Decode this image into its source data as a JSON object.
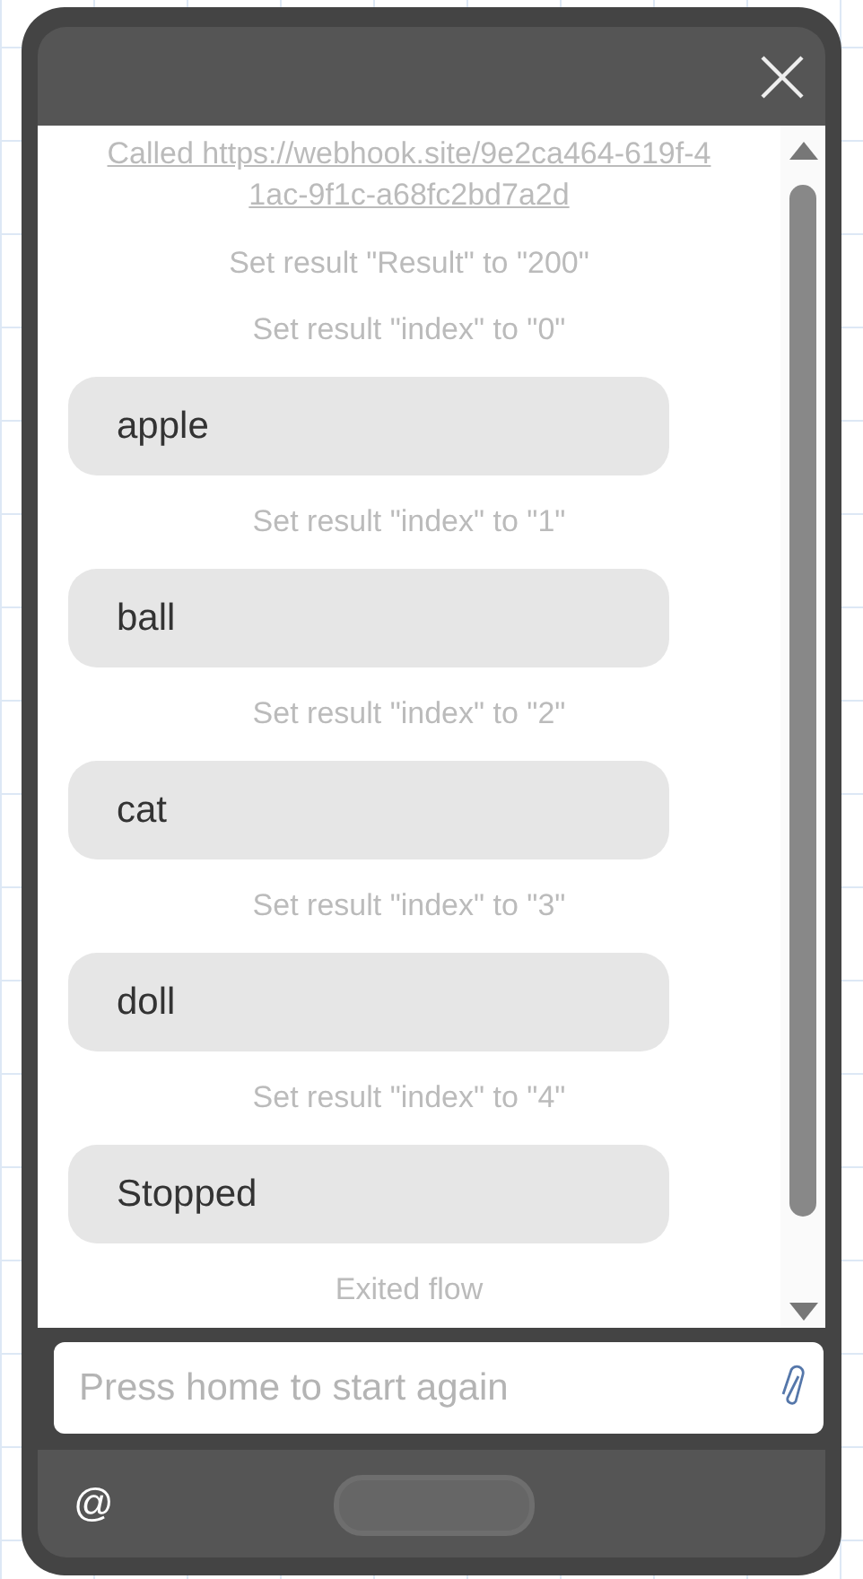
{
  "messages": [
    {
      "kind": "link",
      "text": "Called https://webhook.site/9e2ca464-619f-41ac-9f1c-a68fc2bd7a2d"
    },
    {
      "kind": "status",
      "text": "Set result \"Result\" to \"200\""
    },
    {
      "kind": "status",
      "text": "Set result \"index\" to \"0\""
    },
    {
      "kind": "bubble",
      "text": "apple"
    },
    {
      "kind": "status",
      "text": "Set result \"index\" to \"1\""
    },
    {
      "kind": "bubble",
      "text": "ball"
    },
    {
      "kind": "status",
      "text": "Set result \"index\" to \"2\""
    },
    {
      "kind": "bubble",
      "text": "cat"
    },
    {
      "kind": "status",
      "text": "Set result \"index\" to \"3\""
    },
    {
      "kind": "bubble",
      "text": "doll"
    },
    {
      "kind": "status",
      "text": "Set result \"index\" to \"4\""
    },
    {
      "kind": "bubble",
      "text": "Stopped"
    },
    {
      "kind": "status",
      "text": "Exited flow"
    }
  ],
  "input": {
    "placeholder": "Press home to start again"
  },
  "footer": {
    "mention": "@"
  }
}
